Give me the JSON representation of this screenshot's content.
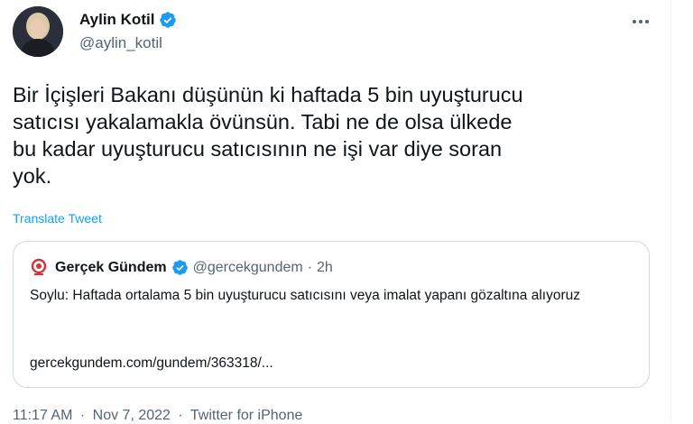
{
  "author": {
    "name": "Aylin Kotil",
    "handle": "@aylin_kotil"
  },
  "tweet": {
    "text": "Bir İçişleri Bakanı düşünün ki haftada 5 bin uyuşturucu\nsatıcısı yakalamakla övünsün. Tabi ne de olsa ülkede\nbu kadar uyuşturucu satıcısının ne işi var diye soran\nyok.",
    "translate_label": "Translate Tweet"
  },
  "quote": {
    "name": "Gerçek Gündem",
    "handle": "@gercekgundem",
    "dot": "·",
    "time": "2h",
    "text": "Soylu: Haftada ortalama 5 bin uyuşturucu satıcısını veya imalat yapanı gözaltına alıyoruz",
    "link": "gercekgundem.com/gundem/363318/..."
  },
  "meta": {
    "time": "11:17 AM",
    "sep1": "·",
    "date": "Nov 7, 2022",
    "sep2": "·",
    "source": "Twitter for iPhone"
  },
  "icons": {
    "verified": "verified-badge-icon",
    "more": "more-options-icon",
    "quote_logo": "gercek-gundem-logo-icon"
  },
  "colors": {
    "accent": "#1d9bf0",
    "secondary_text": "#536471",
    "border": "#cfd9de",
    "quote_logo": "#d6303a"
  }
}
